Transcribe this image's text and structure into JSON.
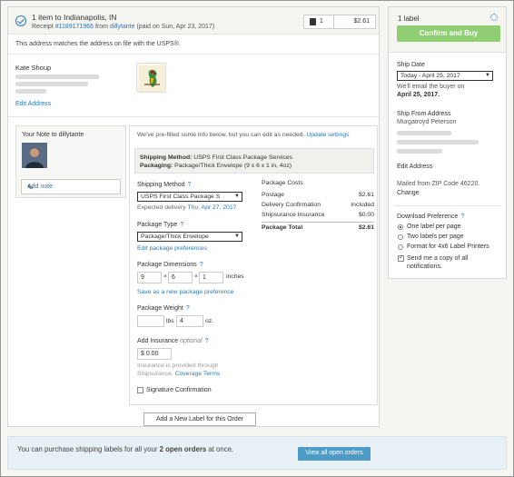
{
  "order": {
    "title": "1 item to Indianapolis, IN",
    "receipt_prefix": "Receipt ",
    "receipt_number": "#1189171966",
    "receipt_from": " from ",
    "seller": "dillytante",
    "paid_on": " (paid on Sun, Apr 23, 2017)",
    "item_count": "1",
    "total": "$2.61"
  },
  "address_notice": "This address matches the address on file with the USPS®.",
  "buyer": {
    "name": "Kate Shoup",
    "edit_address": "Edit Address"
  },
  "note": {
    "title": "Your Note to dillytante",
    "add_note": "Add note"
  },
  "form": {
    "prefill_text": "We've pre-filled some info below, but you can edit as needed.",
    "update_settings": "Update settings",
    "shipping_method_summary_label": "Shipping Method:",
    "shipping_method_summary_value": "USPS First Class Package Services",
    "packaging_summary_label": "Packaging:",
    "packaging_summary_value": "Package/Thick Envelope (9 x 6 x 1 in, 4oz)",
    "shipping_method_label": "Shipping Method",
    "shipping_method_value": "USPS First Class Package S",
    "expected_delivery": "Expected delivery",
    "expected_delivery_date": "Thu, Apr 27, 2017",
    "package_type_label": "Package Type",
    "package_type_value": "Package/Thick Envelope",
    "edit_package_prefs": "Edit package preferences",
    "package_dimensions_label": "Package Dimensions",
    "dim_length": "9",
    "dim_width": "6",
    "dim_height": "1",
    "dim_unit": "inches",
    "save_package": "Save as a new package preference",
    "package_weight_label": "Package Weight",
    "weight_lbs": "",
    "lbs_unit": "lbs",
    "weight_oz": "4",
    "oz_unit": "oz.",
    "add_insurance_label": "Add Insurance",
    "optional": "optional",
    "insurance_value": "$ 0.00",
    "insurance_note_1": "Insurance is provided through",
    "insurance_note_2": "Shipsurance.",
    "coverage_terms": "Coverage Terms",
    "signature_confirmation": "Signature Confirmation",
    "times": "×"
  },
  "costs": {
    "title": "Package Costs",
    "rows": [
      {
        "label": "Postage",
        "value": "$2.61"
      },
      {
        "label": "Delivery Confirmation",
        "value": "Included"
      },
      {
        "label": "Shipsurance Insurance",
        "value": "$0.00"
      }
    ],
    "total_label": "Package Total",
    "total_value": "$2.61"
  },
  "add_label_button": "Add a New Label for this Order",
  "sidebar": {
    "label_count": "1 label",
    "confirm_button": "Confirm and Buy",
    "ship_date_label": "Ship Date",
    "ship_date_value": "Today - April 25, 2017",
    "email_note_1": "We'll email the buyer on",
    "email_note_2": "April 25, 2017.",
    "ship_from_label": "Ship From Address",
    "ship_from_name": "Murgatroyd Peterson",
    "edit_address": "Edit Address",
    "mailed_from": "Mailed from ZIP Code 46220.",
    "change": "Change",
    "download_pref_label": "Download Preference",
    "options": [
      "One label per page",
      "Two labels per page",
      "Format for 4x6 Label Printers"
    ],
    "selected_option": "One label per page",
    "send_copy_1": "Send me a copy of all",
    "send_copy_2": "notifications.",
    "send_copy_checked": true
  },
  "banner": {
    "text_1": "You can purchase shipping labels for all your ",
    "bold": "2 open orders",
    "text_2": " at once.",
    "button": "View all open orders"
  },
  "colors": {
    "link": "#2a7ab8",
    "confirm": "#8fce73",
    "banner_button": "#4e9cc5"
  }
}
